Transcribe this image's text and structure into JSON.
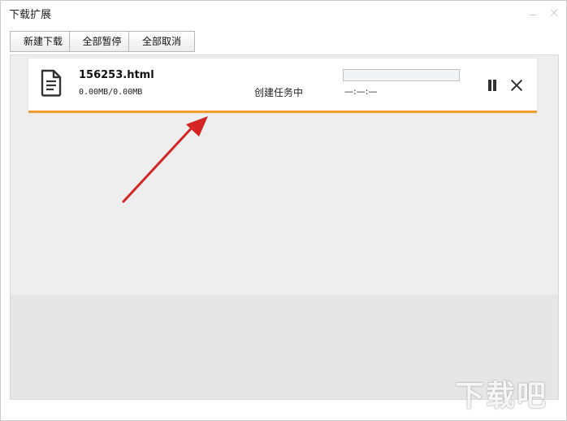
{
  "window": {
    "title": "下载扩展"
  },
  "toolbar": {
    "new_download": "新建下载",
    "pause_all": "全部暂停",
    "cancel_all": "全部取消"
  },
  "downloads": [
    {
      "filename": "156253.html",
      "size": "0.00MB/0.00MB",
      "status": "创建任务中",
      "progress_percent": 0,
      "eta": "—:—:—",
      "icon": "file-document-icon"
    }
  ],
  "annotation": {
    "icon": "red-arrow-icon",
    "color": "#d42424"
  },
  "colors": {
    "accent": "#f39c32"
  },
  "watermark": {
    "text": "下载吧"
  }
}
